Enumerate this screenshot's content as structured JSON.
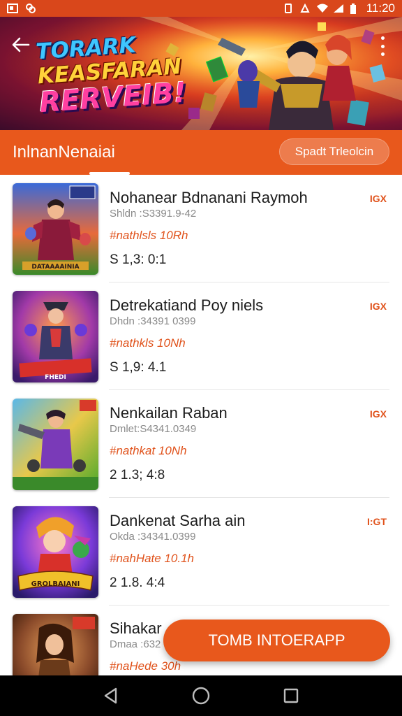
{
  "status_bar": {
    "time": "11:20",
    "icons": [
      "gallery-icon",
      "notification-icon",
      "vibrate-icon",
      "signal-icon",
      "wifi-icon",
      "cell-signal-icon",
      "battery-icon"
    ]
  },
  "banner": {
    "title_line1": "TORARK",
    "title_line2": "KEASFARAN",
    "title_line3": "RERVEIB!",
    "back_icon": "arrow-left-icon",
    "more_icon": "more-vertical-icon"
  },
  "header": {
    "title": "InlnanNenaiai",
    "sort_button": "Spadt Trleolcin"
  },
  "items": [
    {
      "title": "Nohanear Bdnanani Raymoh",
      "subtitle": "Shldn :S3391.9-42",
      "price": "#nathlsls 10Rh",
      "rating": "S 1,3: 0:1",
      "tag": "IGX",
      "thumb_caption": "DATAAAAINIA"
    },
    {
      "title": "Detrekatiand Poy niels",
      "subtitle": "Dhdn :34391 0399",
      "price": "#nathkls 10Nh",
      "rating": "S 1,9: 4.1",
      "tag": "IGX",
      "thumb_caption": "FHEDI"
    },
    {
      "title": "Nenkailan Raban",
      "subtitle": "Dmlet:S4341.0349",
      "price": "#nathkat 10Nh",
      "rating": "2 1.3; 4:8",
      "tag": "IGX",
      "thumb_caption": ""
    },
    {
      "title": "Dankenat Sarha ain",
      "subtitle": "Okda :34341.0399",
      "price": "#nahHate 10.1h",
      "rating": "2 1.8. 4:4",
      "tag": "I:GT",
      "thumb_caption": "GROLBAIANI"
    },
    {
      "title": "Sihakar",
      "subtitle": "Dmaa :632",
      "price": "#naHede 30h",
      "rating": "",
      "tag": "",
      "thumb_caption": ""
    }
  ],
  "fab": {
    "label": "TOMB INTOERAPP"
  },
  "nav": {
    "back": "nav-back-icon",
    "home": "nav-home-icon",
    "recents": "nav-recents-icon"
  },
  "colors": {
    "accent": "#e8581c",
    "status_bar": "#d9471b",
    "price_text": "#e0521b"
  }
}
